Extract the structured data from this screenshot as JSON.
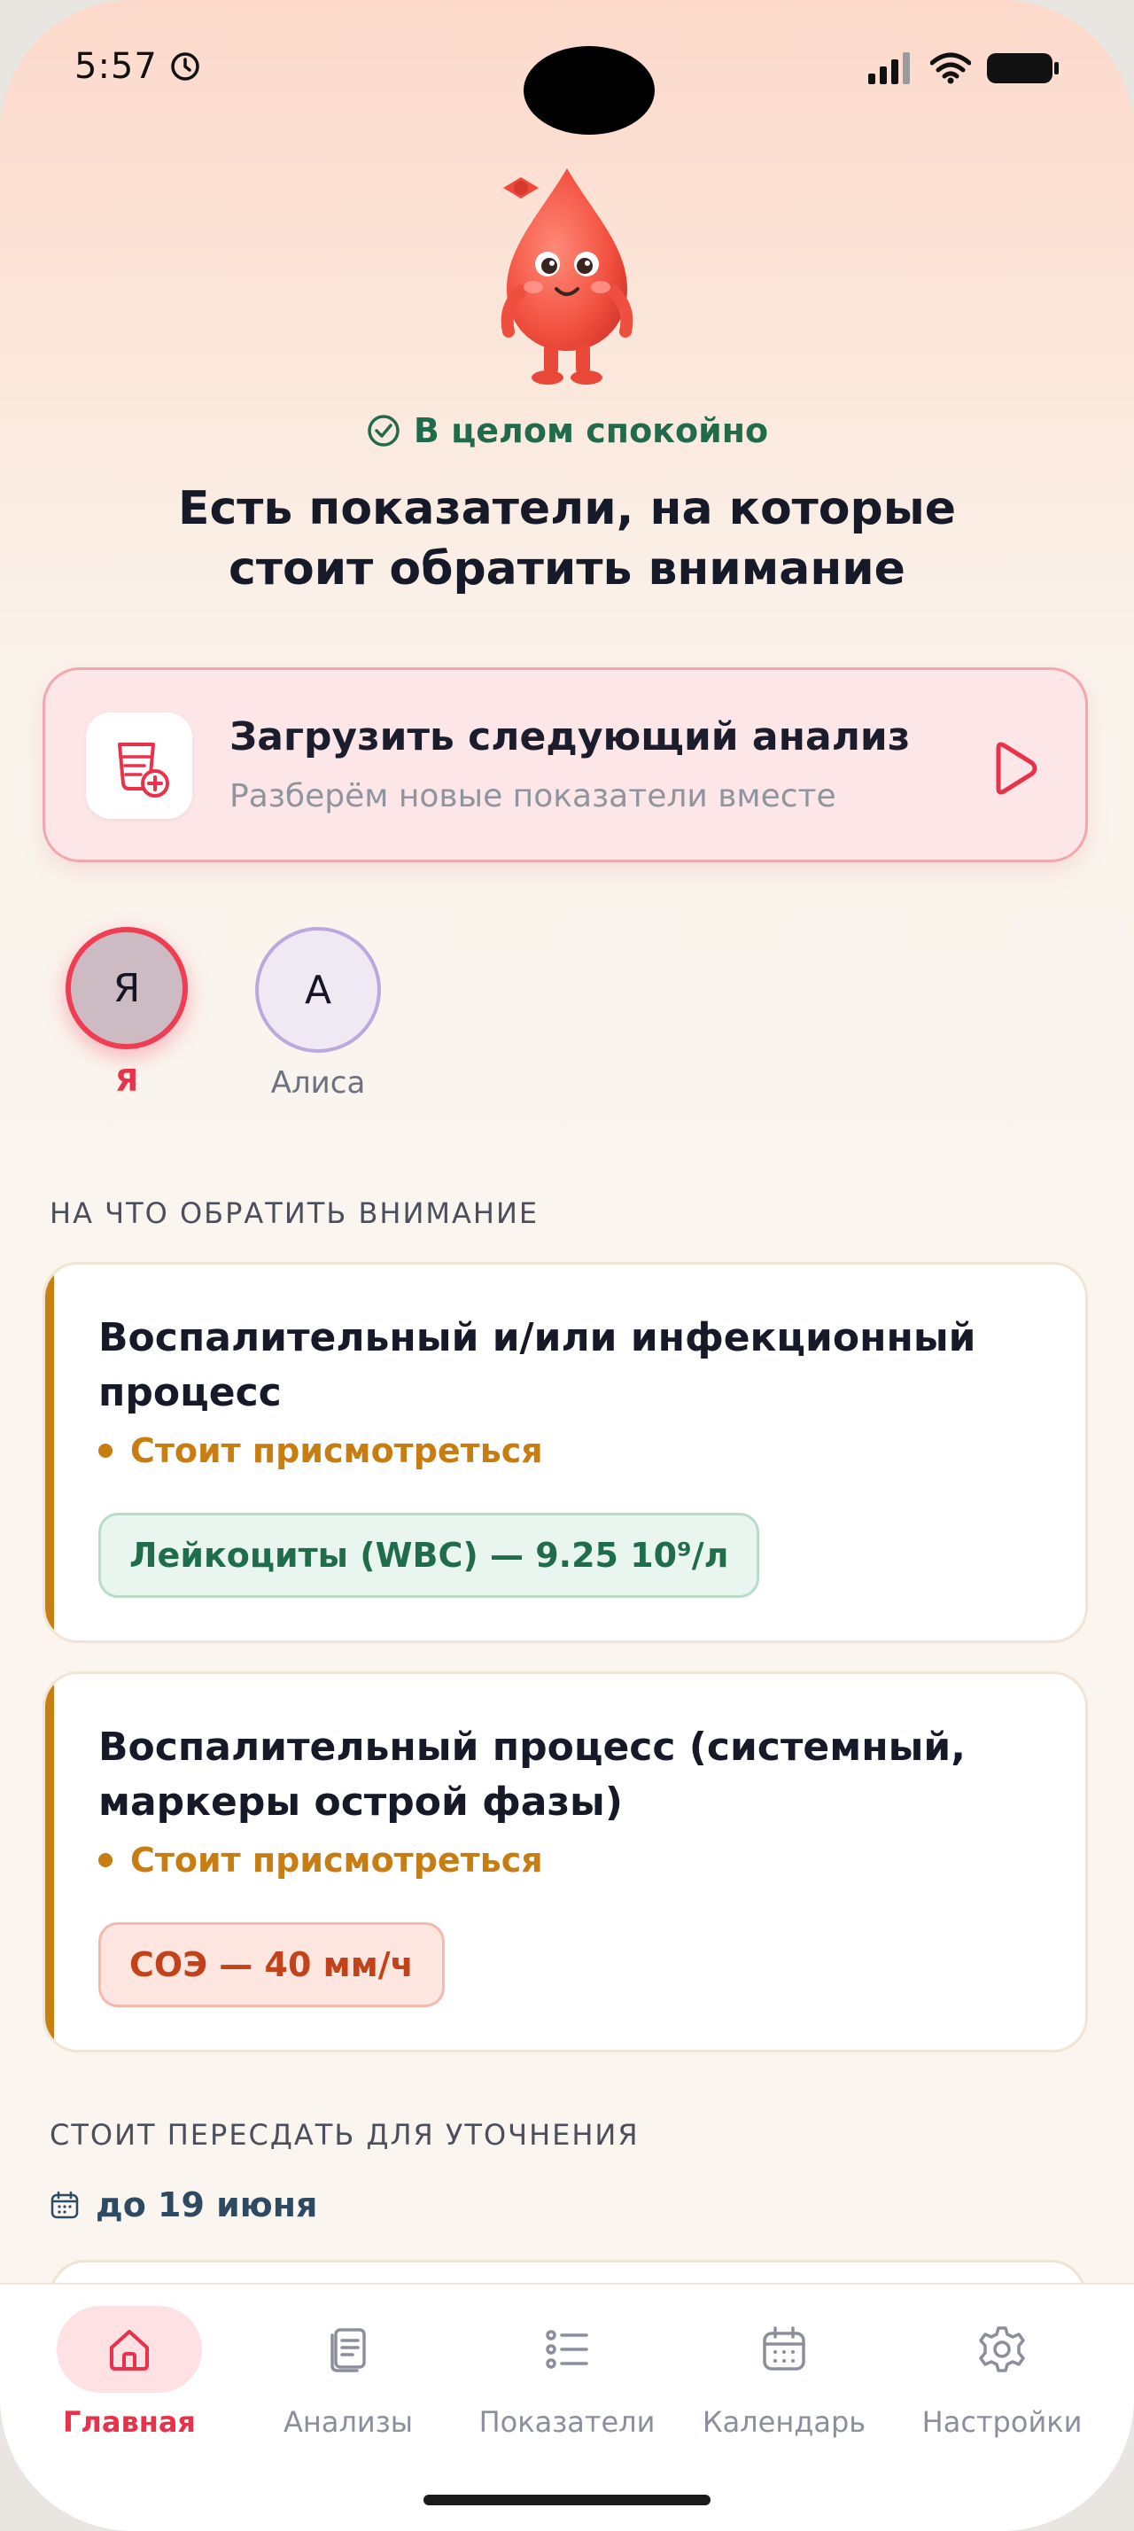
{
  "status_bar": {
    "time": "5:57"
  },
  "hero": {
    "status_text": "В целом спокойно",
    "headline": "Есть показатели, на которые стоит обратить внимание"
  },
  "upload": {
    "title": "Загрузить следующий анализ",
    "subtitle": "Разберём новые показатели вместе"
  },
  "profiles": [
    {
      "initial": "Я",
      "name": "Я",
      "active": true
    },
    {
      "initial": "А",
      "name": "Алиса",
      "active": false
    }
  ],
  "attention": {
    "section_title": "НА ЧТО ОБРАТИТЬ ВНИМАНИЕ",
    "items": [
      {
        "title": "Воспалительный и/или инфекционный процесс",
        "status": "Стоит присмотреться",
        "chip": "Лейкоциты (WBC) — 9.25 10⁹/л"
      },
      {
        "title": "Воспалительный процесс (системный, маркеры острой фазы)",
        "status": "Стоит присмотреться",
        "chip": "СОЭ — 40 мм/ч"
      }
    ]
  },
  "retest": {
    "section_title": "СТОИТ ПЕРЕСДАТЬ ДЛЯ УТОЧНЕНИЯ",
    "date": "до 19 июня"
  },
  "tabs": [
    {
      "label": "Главная",
      "icon": "home-icon",
      "active": true
    },
    {
      "label": "Анализы",
      "icon": "documents-icon",
      "active": false
    },
    {
      "label": "Показатели",
      "icon": "list-icon",
      "active": false
    },
    {
      "label": "Календарь",
      "icon": "calendar-icon",
      "active": false
    },
    {
      "label": "Настройки",
      "icon": "gear-icon",
      "active": false
    }
  ],
  "colors": {
    "accent": "#e93149",
    "positive": "#216b4c",
    "warning": "#c77d12",
    "chip_red_text": "#c2431a"
  }
}
